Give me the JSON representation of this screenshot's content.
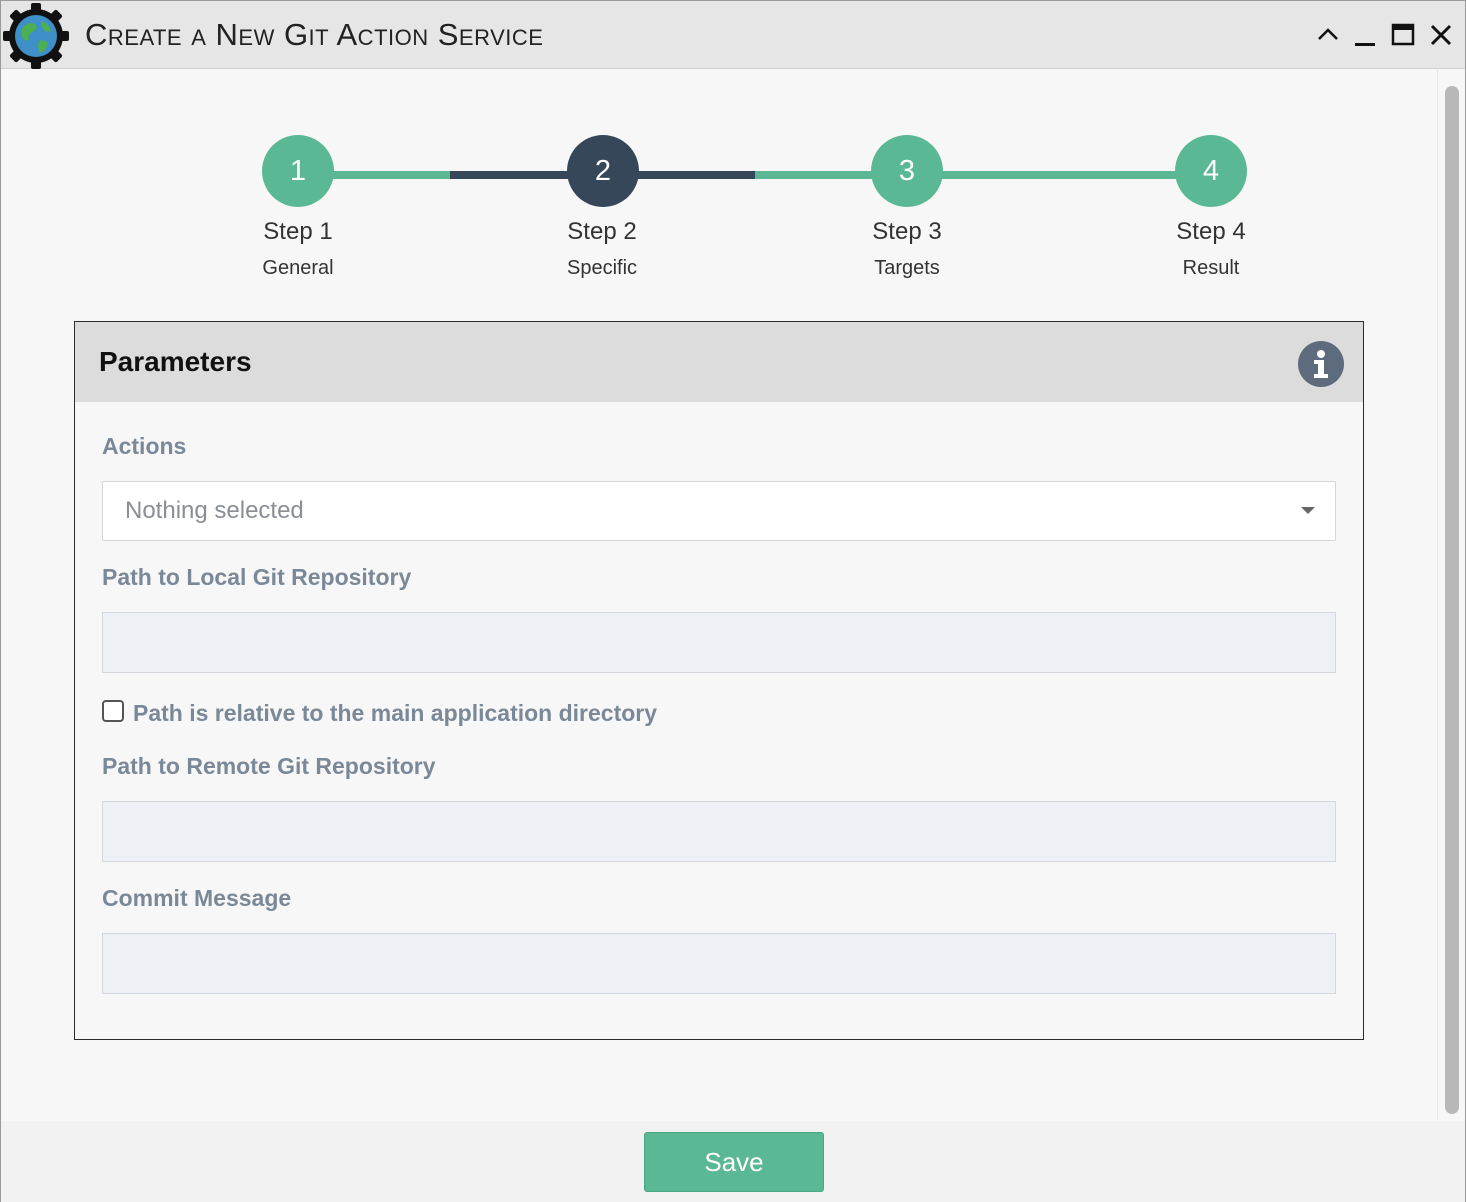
{
  "window": {
    "title": "Create a New Git Action Service",
    "controls": [
      "chevron-up-icon",
      "minimize-icon",
      "maximize-icon",
      "close-icon"
    ]
  },
  "stepper": {
    "steps": [
      {
        "number": "1",
        "title": "Step 1",
        "subtitle": "General",
        "state": "done"
      },
      {
        "number": "2",
        "title": "Step 2",
        "subtitle": "Specific",
        "state": "active"
      },
      {
        "number": "3",
        "title": "Step 3",
        "subtitle": "Targets",
        "state": "pending"
      },
      {
        "number": "4",
        "title": "Step 4",
        "subtitle": "Result",
        "state": "pending"
      }
    ],
    "colors": {
      "done": "#5bb894",
      "active": "#36475a"
    }
  },
  "panel": {
    "title": "Parameters",
    "info_icon": "info-icon",
    "actions_label": "Actions",
    "actions_value": "Nothing selected",
    "local_repo_label": "Path to Local Git Repository",
    "local_repo_value": "",
    "relative_path_label": "Path is relative to the main application directory",
    "relative_path_checked": false,
    "remote_repo_label": "Path to Remote Git Repository",
    "remote_repo_value": "",
    "commit_label": "Commit Message",
    "commit_value": ""
  },
  "footer": {
    "save_label": "Save"
  }
}
